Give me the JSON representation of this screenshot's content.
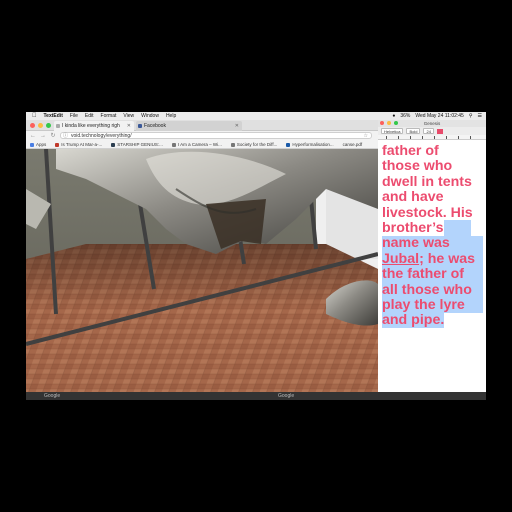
{
  "menubar": {
    "app_name": "TextEdit",
    "menus": [
      "File",
      "Edit",
      "Format",
      "View",
      "Window",
      "Help"
    ],
    "clock": "Wed May 24  11:02:45",
    "battery": "36%"
  },
  "browser": {
    "tabs": [
      {
        "title": "I kinda like everything righ"
      },
      {
        "title": "Facebook"
      }
    ],
    "url": "void.technology/everything/",
    "bookmarks": [
      "Apps",
      "Is Trump At Mar-a-...",
      "STARSHIP GENIUS:...",
      "I Am a Camera – Wi...",
      "Society for the Diff...",
      "Hyperformalisation...",
      "canse.pdf"
    ]
  },
  "document": {
    "title": "Genesis",
    "format_bar": [
      "Helvetica",
      "Bold",
      "24"
    ],
    "text": {
      "line1": "father of",
      "line2": "those who",
      "line3": "dwell in tents",
      "line4": "and have",
      "line5": "livestock. His",
      "line6_a": "brother’s",
      "line7": "name was",
      "line8_link": "Jubal",
      "line8_b": "; he was",
      "line9": "the father of",
      "line10": "all those who",
      "line11": "play the lyre",
      "line12_a": "and pipe."
    }
  },
  "footer": {
    "left": "Google",
    "right": "Google"
  }
}
